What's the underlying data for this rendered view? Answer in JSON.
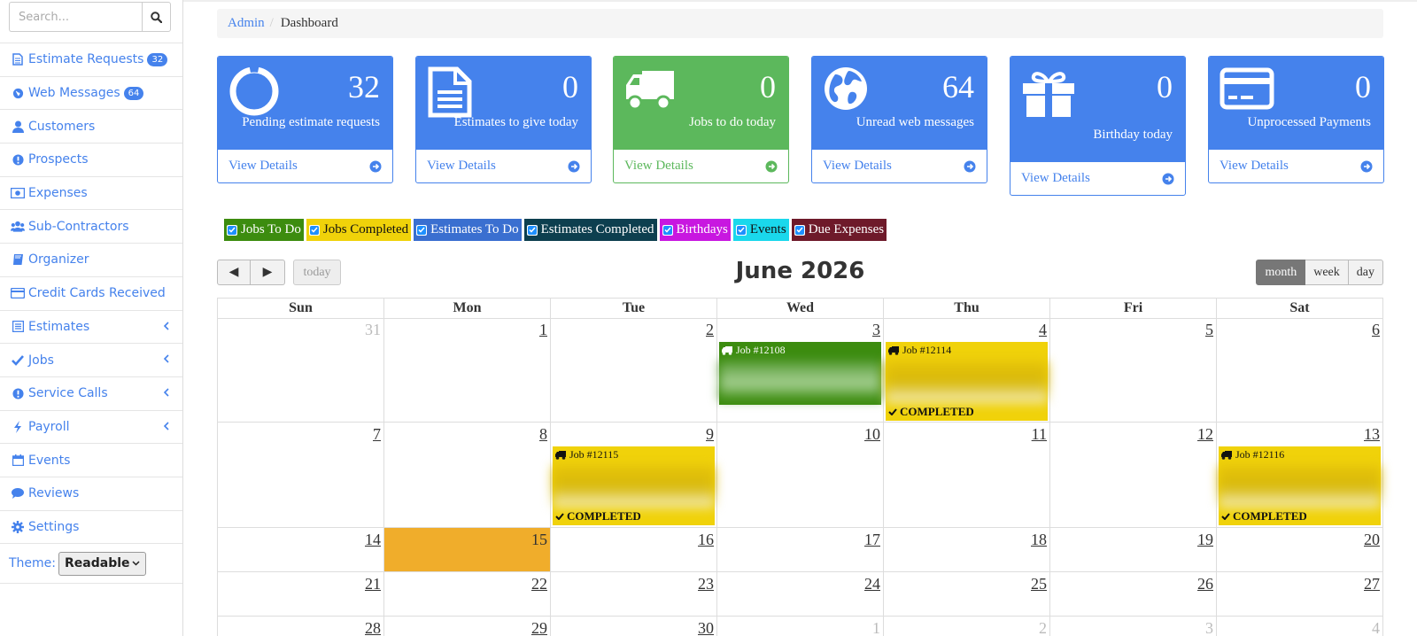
{
  "sidebar": {
    "search_placeholder": "Search...",
    "items": [
      {
        "label": "Estimate Requests",
        "badge": "32",
        "icon": "file-icon"
      },
      {
        "label": "Web Messages",
        "badge": "64",
        "icon": "globe-icon"
      },
      {
        "label": "Customers",
        "icon": "user-icon"
      },
      {
        "label": "Prospects",
        "icon": "exclamation-circle-icon"
      },
      {
        "label": "Expenses",
        "icon": "money-icon"
      },
      {
        "label": "Sub-Contractors",
        "icon": "users-icon"
      },
      {
        "label": "Organizer",
        "icon": "book-icon"
      },
      {
        "label": "Credit Cards Received",
        "icon": "credit-card-icon"
      },
      {
        "label": "Estimates",
        "icon": "list-icon",
        "chevron": true
      },
      {
        "label": "Jobs",
        "icon": "check-icon",
        "chevron": true
      },
      {
        "label": "Service Calls",
        "icon": "exclamation-circle-icon",
        "chevron": true
      },
      {
        "label": "Payroll",
        "icon": "bolt-icon",
        "chevron": true
      },
      {
        "label": "Events",
        "icon": "calendar-icon"
      },
      {
        "label": "Reviews",
        "icon": "comment-icon"
      },
      {
        "label": "Settings",
        "icon": "gear-icon"
      }
    ],
    "theme_label": "Theme:",
    "theme_value": "Readable"
  },
  "breadcrumb": {
    "parent": "Admin",
    "current": "Dashboard"
  },
  "cards": [
    {
      "number": "32",
      "label": "Pending estimate requests",
      "link": "View Details",
      "icon": "circle-notch-icon",
      "color": "#4582ec"
    },
    {
      "number": "0",
      "label": "Estimates to give today",
      "link": "View Details",
      "icon": "file-text-icon",
      "color": "#4582ec"
    },
    {
      "number": "0",
      "label": "Jobs to do today",
      "link": "View Details",
      "icon": "truck-icon",
      "color": "#5cb85c"
    },
    {
      "number": "64",
      "label": "Unread web messages",
      "link": "View Details",
      "icon": "globe-icon",
      "color": "#4582ec"
    },
    {
      "number": "0",
      "label": "Birthday today",
      "link": "View Details",
      "icon": "gift-icon",
      "color": "#4582ec"
    },
    {
      "number": "0",
      "label": "Unprocessed Payments",
      "link": "View Details",
      "icon": "credit-card-icon",
      "color": "#4582ec"
    }
  ],
  "legend": [
    {
      "label": "Jobs To Do",
      "color": "#3c8c0f",
      "text": "#ffffff"
    },
    {
      "label": "Jobs Completed",
      "color": "#f0d20a",
      "text": "#111111"
    },
    {
      "label": "Estimates To Do",
      "color": "#3a6fd0",
      "text": "#ffffff"
    },
    {
      "label": "Estimates Completed",
      "color": "#0d3f4f",
      "text": "#ffffff"
    },
    {
      "label": "Birthdays",
      "color": "#c817e0",
      "text": "#ffffff"
    },
    {
      "label": "Events",
      "color": "#1ad8ec",
      "text": "#111111"
    },
    {
      "label": "Due Expenses",
      "color": "#6e1a2a",
      "text": "#ffffff"
    }
  ],
  "calendar": {
    "title": "June 2026",
    "prev": "◀",
    "next": "▶",
    "today": "today",
    "views": [
      "month",
      "week",
      "day"
    ],
    "weekdays": [
      "Sun",
      "Mon",
      "Tue",
      "Wed",
      "Thu",
      "Fri",
      "Sat"
    ],
    "weeks": [
      [
        "31",
        "1",
        "2",
        "3",
        "4",
        "5",
        "6"
      ],
      [
        "7",
        "8",
        "9",
        "10",
        "11",
        "12",
        "13"
      ],
      [
        "14",
        "15",
        "16",
        "17",
        "18",
        "19",
        "20"
      ],
      [
        "21",
        "22",
        "23",
        "24",
        "25",
        "26",
        "27"
      ],
      [
        "28",
        "29",
        "30",
        "1",
        "2",
        "3",
        "4"
      ]
    ],
    "events": [
      {
        "title": "Job #12108",
        "completed_label": ""
      },
      {
        "title": "Job #12114",
        "completed_label": "COMPLETED"
      },
      {
        "title": "Job #12115",
        "completed_label": "COMPLETED"
      },
      {
        "title": "Job #12116",
        "completed_label": "COMPLETED"
      }
    ]
  }
}
